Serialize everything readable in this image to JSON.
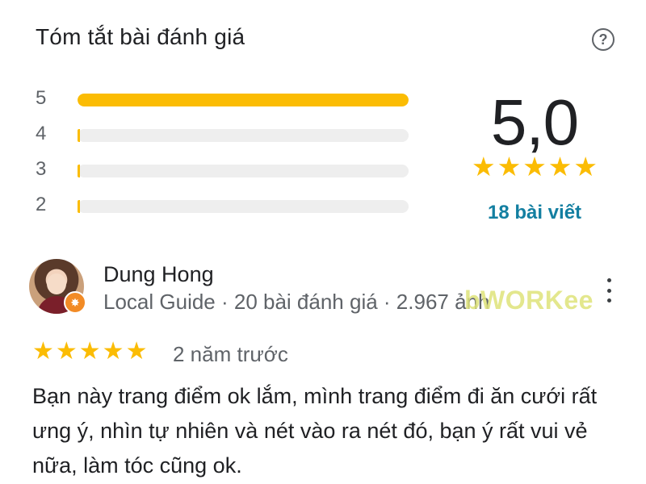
{
  "header": {
    "title": "Tóm tắt bài đánh giá",
    "help_icon": "help-circle-icon",
    "help_glyph": "?"
  },
  "distribution": {
    "rows": [
      {
        "label": "5",
        "fraction": 1.0
      },
      {
        "label": "4",
        "fraction": 0.0
      },
      {
        "label": "3",
        "fraction": 0.0
      },
      {
        "label": "2",
        "fraction": 0.0
      }
    ],
    "bar_color": "#fbbc04"
  },
  "summary": {
    "score": "5,0",
    "stars": "★★★★★",
    "review_count": "18 bài viết"
  },
  "review": {
    "author": "Dung Hong",
    "meta": "Local Guide · 20 bài đánh giá · 2.967 ảnh",
    "badge_glyph": "✸",
    "stars": "★★★★★",
    "date": "2 năm trước",
    "text": "Bạn này trang điểm ok lắm, mình trang điểm đi ăn cưới rất ưng ý, nhìn tự nhiên và nét vào ra nét đó, bạn ý rất vui vẻ nữa, làm tóc cũng ok."
  },
  "watermark": "bWORKee"
}
